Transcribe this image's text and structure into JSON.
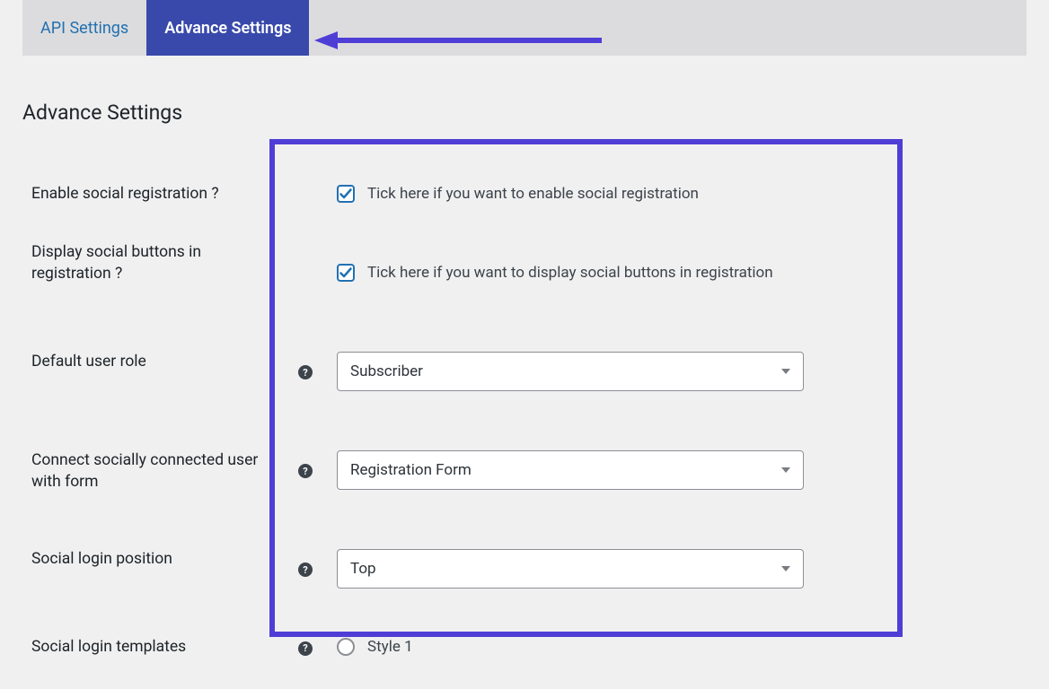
{
  "tabs": {
    "api": "API Settings",
    "advance": "Advance Settings"
  },
  "pageTitle": "Advance Settings",
  "fields": {
    "enableSocialReg": {
      "label": "Enable social registration ?",
      "hint": "Tick here if you want to enable social registration"
    },
    "displaySocialButtons": {
      "label": "Display social buttons in registration ?",
      "hint": "Tick here if you want to display social buttons in registration"
    },
    "defaultUserRole": {
      "label": "Default user role",
      "value": "Subscriber"
    },
    "connectSocially": {
      "label": "Connect socially connected user with form",
      "value": "Registration Form"
    },
    "socialLoginPosition": {
      "label": "Social login position",
      "value": "Top"
    },
    "socialLoginTemplates": {
      "label": "Social login templates",
      "option1": "Style 1"
    }
  },
  "helpGlyph": "?"
}
